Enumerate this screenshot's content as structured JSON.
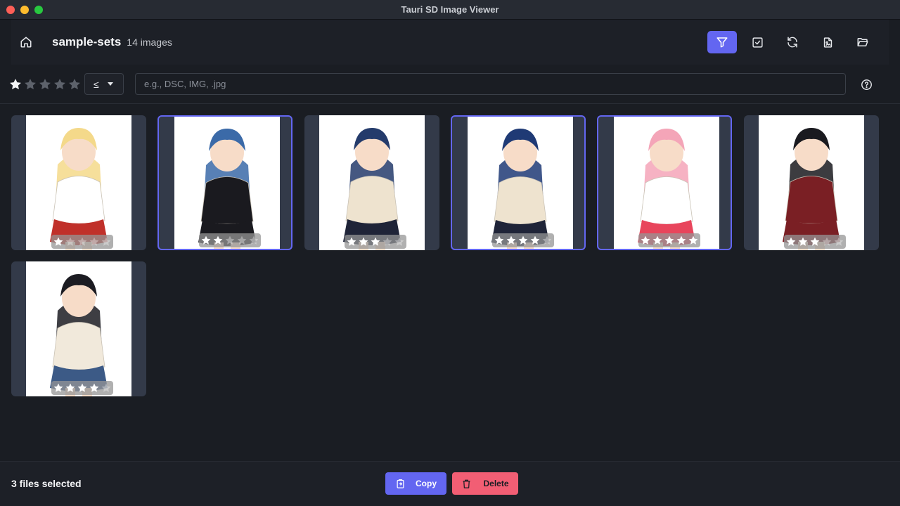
{
  "window": {
    "title": "Tauri SD Image Viewer"
  },
  "header": {
    "folder_name": "sample-sets",
    "image_count": "14 images",
    "actions": [
      {
        "icon": "filter-icon",
        "active": true
      },
      {
        "icon": "check-square-icon",
        "active": false
      },
      {
        "icon": "refresh-icon",
        "active": false
      },
      {
        "icon": "file-image-icon",
        "active": false
      },
      {
        "icon": "folder-open-icon",
        "active": false
      }
    ]
  },
  "filter": {
    "rating_value": 1,
    "rating_max": 5,
    "comparator": "≤",
    "search_placeholder": "e.g., DSC, IMG, .jpg",
    "search_value": ""
  },
  "images": [
    {
      "rating": 1,
      "selected": false,
      "hair": "#f4d98a",
      "outfit": "#ffffff",
      "skirt": "#c0302a"
    },
    {
      "rating": 2,
      "selected": true,
      "hair": "#3b6aa8",
      "outfit": "#1a1a1f",
      "skirt": "#1a1a1f"
    },
    {
      "rating": 3,
      "selected": false,
      "hair": "#243b6b",
      "outfit": "#eee3cf",
      "skirt": "#1f2438"
    },
    {
      "rating": 4,
      "selected": true,
      "hair": "#1f3a75",
      "outfit": "#eee3cf",
      "skirt": "#1f2438"
    },
    {
      "rating": 5,
      "selected": true,
      "hair": "#f4a5b8",
      "outfit": "#ffffff",
      "skirt": "#e8455c"
    },
    {
      "rating": 3,
      "selected": false,
      "hair": "#1a1a1f",
      "outfit": "#7a1f24",
      "skirt": "#7a1f24"
    },
    {
      "rating": 4,
      "selected": false,
      "hair": "#1c1c22",
      "outfit": "#f1e9db",
      "skirt": "#3c5a86"
    }
  ],
  "footer": {
    "selection_text": "3 files selected",
    "copy_label": "Copy",
    "delete_label": "Delete"
  },
  "colors": {
    "accent": "#6366f1",
    "danger": "#f25e74",
    "card": "#333a49",
    "background": "#1a1d23"
  }
}
